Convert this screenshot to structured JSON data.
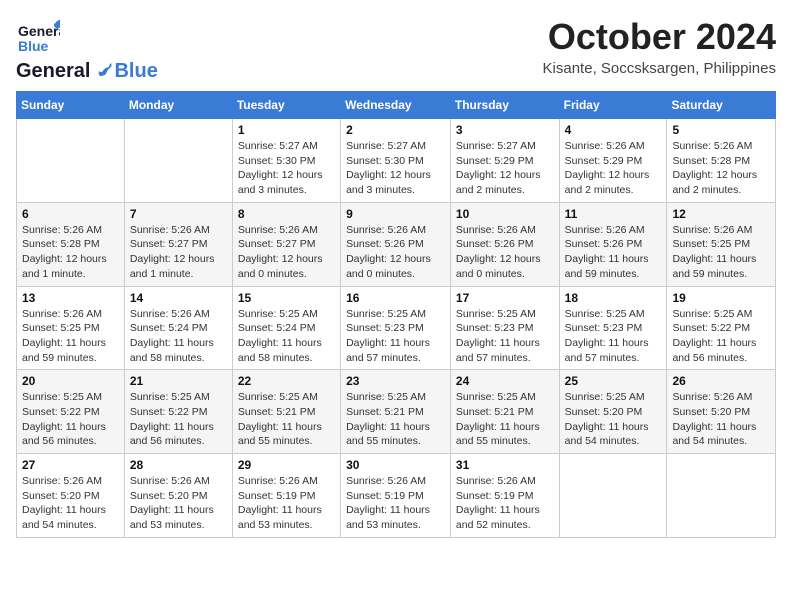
{
  "header": {
    "logo_general": "General",
    "logo_blue": "Blue",
    "month_title": "October 2024",
    "location": "Kisante, Soccsksargen, Philippines"
  },
  "weekdays": [
    "Sunday",
    "Monday",
    "Tuesday",
    "Wednesday",
    "Thursday",
    "Friday",
    "Saturday"
  ],
  "weeks": [
    [
      {
        "day": "",
        "info": ""
      },
      {
        "day": "",
        "info": ""
      },
      {
        "day": "1",
        "info": "Sunrise: 5:27 AM\nSunset: 5:30 PM\nDaylight: 12 hours\nand 3 minutes."
      },
      {
        "day": "2",
        "info": "Sunrise: 5:27 AM\nSunset: 5:30 PM\nDaylight: 12 hours\nand 3 minutes."
      },
      {
        "day": "3",
        "info": "Sunrise: 5:27 AM\nSunset: 5:29 PM\nDaylight: 12 hours\nand 2 minutes."
      },
      {
        "day": "4",
        "info": "Sunrise: 5:26 AM\nSunset: 5:29 PM\nDaylight: 12 hours\nand 2 minutes."
      },
      {
        "day": "5",
        "info": "Sunrise: 5:26 AM\nSunset: 5:28 PM\nDaylight: 12 hours\nand 2 minutes."
      }
    ],
    [
      {
        "day": "6",
        "info": "Sunrise: 5:26 AM\nSunset: 5:28 PM\nDaylight: 12 hours\nand 1 minute."
      },
      {
        "day": "7",
        "info": "Sunrise: 5:26 AM\nSunset: 5:27 PM\nDaylight: 12 hours\nand 1 minute."
      },
      {
        "day": "8",
        "info": "Sunrise: 5:26 AM\nSunset: 5:27 PM\nDaylight: 12 hours\nand 0 minutes."
      },
      {
        "day": "9",
        "info": "Sunrise: 5:26 AM\nSunset: 5:26 PM\nDaylight: 12 hours\nand 0 minutes."
      },
      {
        "day": "10",
        "info": "Sunrise: 5:26 AM\nSunset: 5:26 PM\nDaylight: 12 hours\nand 0 minutes."
      },
      {
        "day": "11",
        "info": "Sunrise: 5:26 AM\nSunset: 5:26 PM\nDaylight: 11 hours\nand 59 minutes."
      },
      {
        "day": "12",
        "info": "Sunrise: 5:26 AM\nSunset: 5:25 PM\nDaylight: 11 hours\nand 59 minutes."
      }
    ],
    [
      {
        "day": "13",
        "info": "Sunrise: 5:26 AM\nSunset: 5:25 PM\nDaylight: 11 hours\nand 59 minutes."
      },
      {
        "day": "14",
        "info": "Sunrise: 5:26 AM\nSunset: 5:24 PM\nDaylight: 11 hours\nand 58 minutes."
      },
      {
        "day": "15",
        "info": "Sunrise: 5:25 AM\nSunset: 5:24 PM\nDaylight: 11 hours\nand 58 minutes."
      },
      {
        "day": "16",
        "info": "Sunrise: 5:25 AM\nSunset: 5:23 PM\nDaylight: 11 hours\nand 57 minutes."
      },
      {
        "day": "17",
        "info": "Sunrise: 5:25 AM\nSunset: 5:23 PM\nDaylight: 11 hours\nand 57 minutes."
      },
      {
        "day": "18",
        "info": "Sunrise: 5:25 AM\nSunset: 5:23 PM\nDaylight: 11 hours\nand 57 minutes."
      },
      {
        "day": "19",
        "info": "Sunrise: 5:25 AM\nSunset: 5:22 PM\nDaylight: 11 hours\nand 56 minutes."
      }
    ],
    [
      {
        "day": "20",
        "info": "Sunrise: 5:25 AM\nSunset: 5:22 PM\nDaylight: 11 hours\nand 56 minutes."
      },
      {
        "day": "21",
        "info": "Sunrise: 5:25 AM\nSunset: 5:22 PM\nDaylight: 11 hours\nand 56 minutes."
      },
      {
        "day": "22",
        "info": "Sunrise: 5:25 AM\nSunset: 5:21 PM\nDaylight: 11 hours\nand 55 minutes."
      },
      {
        "day": "23",
        "info": "Sunrise: 5:25 AM\nSunset: 5:21 PM\nDaylight: 11 hours\nand 55 minutes."
      },
      {
        "day": "24",
        "info": "Sunrise: 5:25 AM\nSunset: 5:21 PM\nDaylight: 11 hours\nand 55 minutes."
      },
      {
        "day": "25",
        "info": "Sunrise: 5:25 AM\nSunset: 5:20 PM\nDaylight: 11 hours\nand 54 minutes."
      },
      {
        "day": "26",
        "info": "Sunrise: 5:26 AM\nSunset: 5:20 PM\nDaylight: 11 hours\nand 54 minutes."
      }
    ],
    [
      {
        "day": "27",
        "info": "Sunrise: 5:26 AM\nSunset: 5:20 PM\nDaylight: 11 hours\nand 54 minutes."
      },
      {
        "day": "28",
        "info": "Sunrise: 5:26 AM\nSunset: 5:20 PM\nDaylight: 11 hours\nand 53 minutes."
      },
      {
        "day": "29",
        "info": "Sunrise: 5:26 AM\nSunset: 5:19 PM\nDaylight: 11 hours\nand 53 minutes."
      },
      {
        "day": "30",
        "info": "Sunrise: 5:26 AM\nSunset: 5:19 PM\nDaylight: 11 hours\nand 53 minutes."
      },
      {
        "day": "31",
        "info": "Sunrise: 5:26 AM\nSunset: 5:19 PM\nDaylight: 11 hours\nand 52 minutes."
      },
      {
        "day": "",
        "info": ""
      },
      {
        "day": "",
        "info": ""
      }
    ]
  ]
}
